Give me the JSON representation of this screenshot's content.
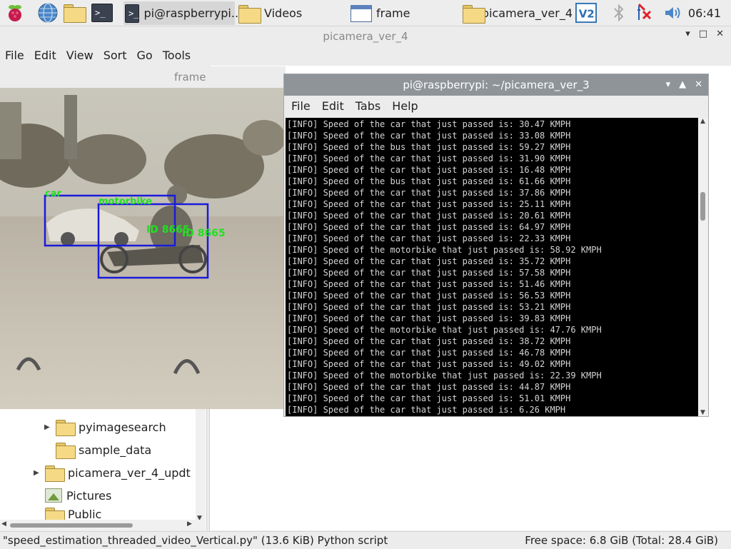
{
  "taskbar": {
    "tasks": [
      {
        "label": "pi@raspberrypi..."
      },
      {
        "label": "Videos"
      },
      {
        "label": "frame"
      },
      {
        "label": "picamera_ver_4"
      }
    ],
    "clock": "06:41"
  },
  "file_manager": {
    "title": "picamera_ver_4",
    "menu": [
      "File",
      "Edit",
      "View",
      "Sort",
      "Go",
      "Tools"
    ],
    "tree": [
      {
        "label": "pyimagesearch"
      },
      {
        "label": "sample_data"
      },
      {
        "label": "picamera_ver_4_updt"
      },
      {
        "label": "Pictures"
      },
      {
        "label": "Public"
      }
    ],
    "status_left": "\"speed_estimation_threaded_video_Vertical.py\" (13.6 KiB) Python script",
    "status_right": "Free space: 6.8 GiB (Total: 28.4 GiB)"
  },
  "frame_window": {
    "title": "frame",
    "detections": [
      {
        "label": "car",
        "id_label": ""
      },
      {
        "label": "motorbike",
        "id_label": "ID 8665"
      }
    ],
    "overlay_ids": [
      "ID 8665",
      "ID 8665"
    ]
  },
  "terminal": {
    "title": "pi@raspberrypi: ~/picamera_ver_3",
    "menu": [
      "File",
      "Edit",
      "Tabs",
      "Help"
    ],
    "lines": [
      "[INFO] Speed of the car that just passed is: 30.47 KMPH",
      "[INFO] Speed of the car that just passed is: 33.08 KMPH",
      "[INFO] Speed of the bus that just passed is: 59.27 KMPH",
      "[INFO] Speed of the car that just passed is: 31.90 KMPH",
      "[INFO] Speed of the car that just passed is: 16.48 KMPH",
      "[INFO] Speed of the bus that just passed is: 61.66 KMPH",
      "[INFO] Speed of the car that just passed is: 37.86 KMPH",
      "[INFO] Speed of the car that just passed is: 25.11 KMPH",
      "[INFO] Speed of the car that just passed is: 20.61 KMPH",
      "[INFO] Speed of the car that just passed is: 64.97 KMPH",
      "[INFO] Speed of the car that just passed is: 22.33 KMPH",
      "[INFO] Speed of the motorbike that just passed is: 58.92 KMPH",
      "[INFO] Speed of the car that just passed is: 35.72 KMPH",
      "[INFO] Speed of the car that just passed is: 57.58 KMPH",
      "[INFO] Speed of the car that just passed is: 51.46 KMPH",
      "[INFO] Speed of the car that just passed is: 56.53 KMPH",
      "[INFO] Speed of the car that just passed is: 53.21 KMPH",
      "[INFO] Speed of the car that just passed is: 39.83 KMPH",
      "[INFO] Speed of the motorbike that just passed is: 47.76 KMPH",
      "[INFO] Speed of the car that just passed is: 38.72 KMPH",
      "[INFO] Speed of the car that just passed is: 46.78 KMPH",
      "[INFO] Speed of the car that just passed is: 49.02 KMPH",
      "[INFO] Speed of the motorbike that just passed is: 22.39 KMPH",
      "[INFO] Speed of the car that just passed is: 44.87 KMPH",
      "[INFO] Speed of the car that just passed is: 51.01 KMPH",
      "[INFO] Speed of the car that just passed is: 6.26 KMPH"
    ]
  },
  "colors": {
    "terminal_bg": "#000000",
    "terminal_fg": "#d4d4d4",
    "bbox": "#1a1adb",
    "label": "#22e022",
    "title_bar_active": "#8f9499"
  }
}
